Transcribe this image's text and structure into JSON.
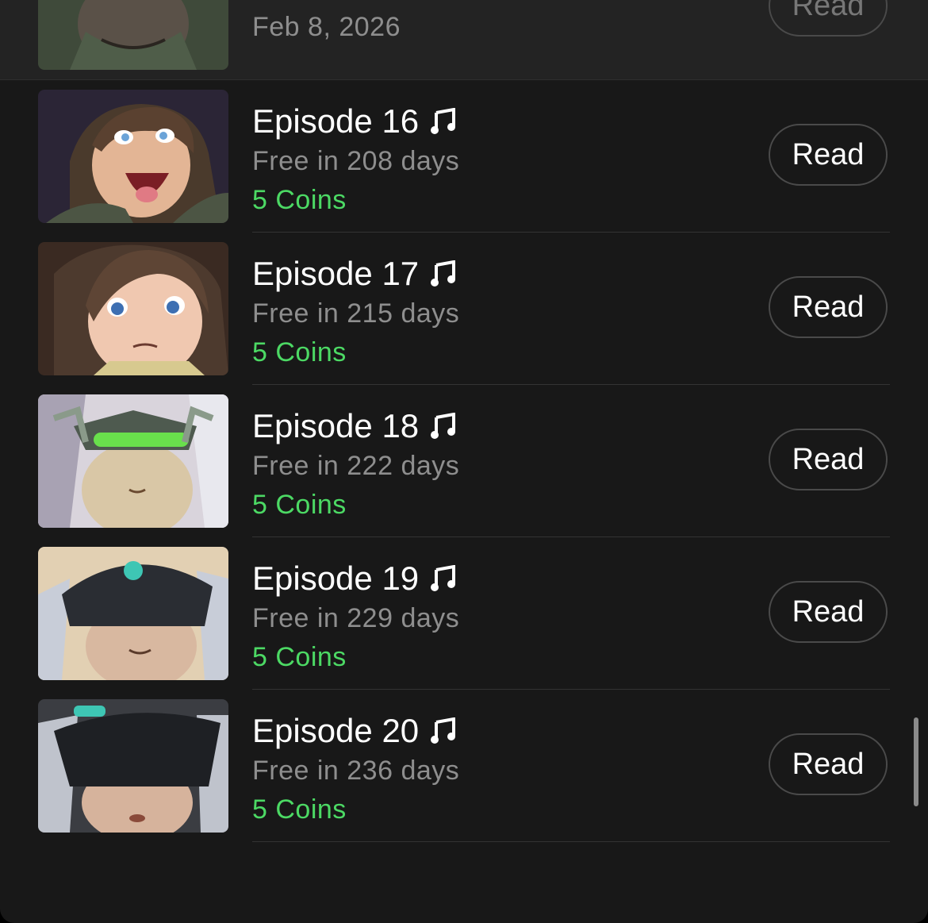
{
  "previous_episode": {
    "date": "Feb 8, 2026",
    "button_label": "Read"
  },
  "episodes": [
    {
      "title": "Episode 16",
      "free_text": "Free in 208 days",
      "price": "5 Coins",
      "button_label": "Read",
      "icon": "music-note-icon"
    },
    {
      "title": "Episode 17",
      "free_text": "Free in 215 days",
      "price": "5 Coins",
      "button_label": "Read",
      "icon": "music-note-icon"
    },
    {
      "title": "Episode 18",
      "free_text": "Free in 222 days",
      "price": "5 Coins",
      "button_label": "Read",
      "icon": "music-note-icon"
    },
    {
      "title": "Episode 19",
      "free_text": "Free in 229 days",
      "price": "5 Coins",
      "button_label": "Read",
      "icon": "music-note-icon"
    },
    {
      "title": "Episode 20",
      "free_text": "Free in 236 days",
      "price": "5 Coins",
      "button_label": "Read",
      "icon": "music-note-icon"
    }
  ],
  "colors": {
    "background": "#181818",
    "primary_text": "#ffffff",
    "secondary_text": "#8e8e8e",
    "price_text": "#4cd964",
    "button_border": "#4a4a4a"
  }
}
